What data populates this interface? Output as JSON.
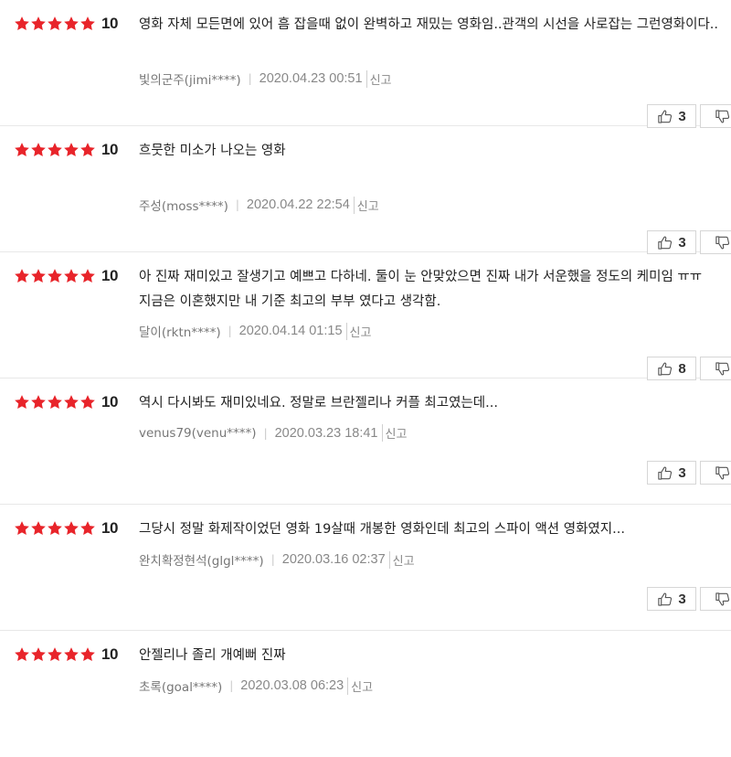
{
  "star_color": "#e8242a",
  "reviews": [
    {
      "score": "10",
      "text": "영화 자체 모든면에 있어 흠 잡을때 없이 완벽하고 재밌는 영화임..관객의 시선을 사로잡는 그런영화이다..",
      "author": "빛의군주(jimi****)",
      "date": "2020.04.23 00:51",
      "report": "신고",
      "likes": "3",
      "dislikes": ""
    },
    {
      "score": "10",
      "text": "흐뭇한 미소가 나오는 영화",
      "author": "주성(moss****)",
      "date": "2020.04.22 22:54",
      "report": "신고",
      "likes": "3",
      "dislikes": ""
    },
    {
      "score": "10",
      "text": "아 진짜 재미있고 잘생기고 예쁘고 다하네. 둘이 눈 안맞았으면 진짜 내가 서운했을 정도의 케미임 ㅠㅠ 지금은 이혼했지만 내 기준 최고의 부부 였다고 생각함.",
      "author": "달이(rktn****)",
      "date": "2020.04.14 01:15",
      "report": "신고",
      "likes": "8",
      "dislikes": ""
    },
    {
      "score": "10",
      "text": "역시 다시봐도 재미있네요. 정말로 브란젤리나 커플 최고였는데...",
      "author": "venus79(venu****)",
      "date": "2020.03.23 18:41",
      "report": "신고",
      "likes": "3",
      "dislikes": ""
    },
    {
      "score": "10",
      "text": "그당시 정말 화제작이었던 영화 19살때 개봉한 영화인데 최고의 스파이 액션 영화였지...",
      "author": "완치확정현석(glgl****)",
      "date": "2020.03.16 02:37",
      "report": "신고",
      "likes": "3",
      "dislikes": ""
    },
    {
      "score": "10",
      "text": "안젤리나 졸리 개예뻐 진짜",
      "author": "초록(goal****)",
      "date": "2020.03.08 06:23",
      "report": "신고",
      "likes": "",
      "dislikes": ""
    }
  ]
}
